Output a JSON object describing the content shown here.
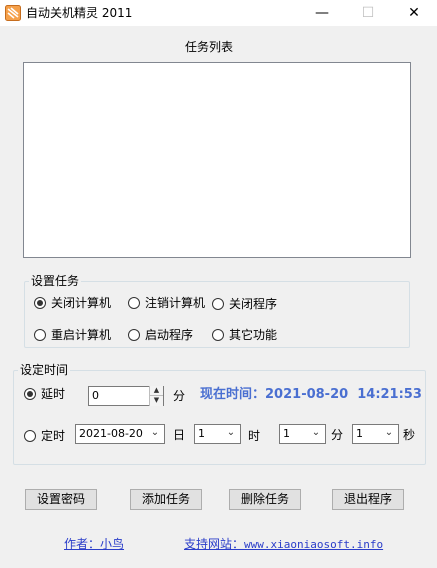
{
  "window": {
    "title": "自动关机精灵 2011"
  },
  "task_list": {
    "caption": "任务列表"
  },
  "set_task": {
    "legend": "设置任务",
    "options": [
      {
        "label": "关闭计算机",
        "checked": true
      },
      {
        "label": "注销计算机",
        "checked": false
      },
      {
        "label": "关闭程序",
        "checked": false
      },
      {
        "label": "重启计算机",
        "checked": false
      },
      {
        "label": "启动程序",
        "checked": false
      },
      {
        "label": "其它功能",
        "checked": false
      }
    ]
  },
  "set_time": {
    "legend": "设定时间",
    "delay": {
      "label": "延时",
      "value": "0",
      "unit": "分",
      "checked": true
    },
    "current_time": {
      "label": "现在时间：",
      "value": "2021-08-20  14:21:53"
    },
    "scheduled": {
      "label": "定时",
      "checked": false,
      "date": "2021-08-20",
      "day_unit": "日",
      "day": "1",
      "hour_unit": "时",
      "hour": "1",
      "minute_unit": "分",
      "minute": "1",
      "second_unit": "秒"
    }
  },
  "buttons": {
    "set_password": "设置密码",
    "add_task": "添加任务",
    "delete_task": "删除任务",
    "exit": "退出程序"
  },
  "footer": {
    "author_label": "作者：",
    "author": "小鸟",
    "site_label": "支持网站：",
    "site": "www.xiaoniaosoft.info"
  },
  "colors": {
    "accent": "#4a6fd1",
    "link": "#2a3dc9"
  }
}
